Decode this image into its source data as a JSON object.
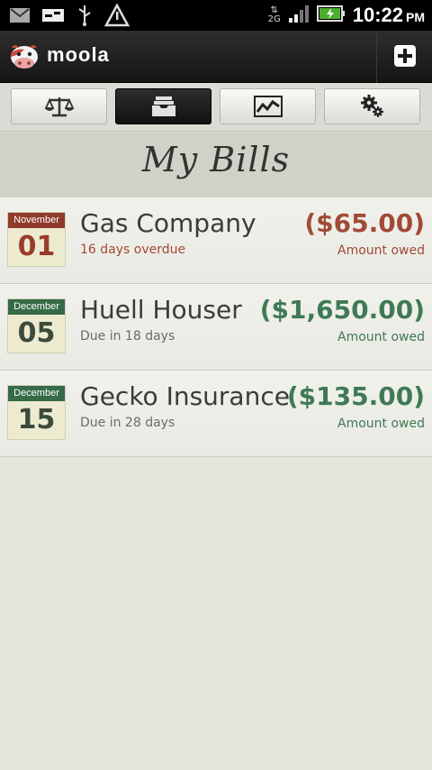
{
  "status_bar": {
    "time": "10:22",
    "ampm": "PM",
    "network": "2G",
    "icons": [
      "gmail-icon",
      "voicemail-icon",
      "usb-icon",
      "warning-icon"
    ]
  },
  "app": {
    "title": "moola",
    "add_label": "+"
  },
  "tabs": [
    {
      "name": "balance",
      "icon": "scale-icon",
      "active": false
    },
    {
      "name": "bills",
      "icon": "inbox-tray-icon",
      "active": true
    },
    {
      "name": "trends",
      "icon": "line-chart-icon",
      "active": false
    },
    {
      "name": "settings",
      "icon": "gears-icon",
      "active": false
    }
  ],
  "page_title": "My Bills",
  "bills": [
    {
      "month": "November",
      "day": "01",
      "name": "Gas Company",
      "status": "16  days overdue",
      "amount": "($65.00)",
      "amount_label": "Amount owed",
      "state": "overdue",
      "color": "#a14a35"
    },
    {
      "month": "December",
      "day": "05",
      "name": "Huell Houser",
      "status": "Due in  18  days",
      "amount": "($1,650.00)",
      "amount_label": "Amount owed",
      "state": "upcoming",
      "color": "#3f7a55"
    },
    {
      "month": "December",
      "day": "15",
      "name": "Gecko Insurance",
      "status": "Due in  28  days",
      "amount": "($135.00)",
      "amount_label": "Amount owed",
      "state": "upcoming",
      "color": "#3f7a55"
    }
  ]
}
